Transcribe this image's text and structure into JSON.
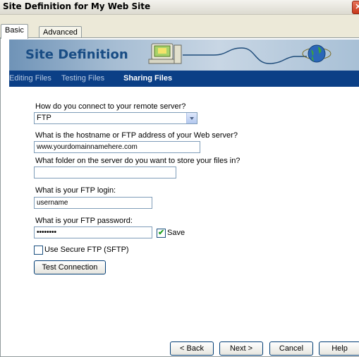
{
  "window": {
    "title": "Site Definition for My Web Site",
    "close_glyph": "✕"
  },
  "tabs": [
    {
      "label": "Basic"
    },
    {
      "label": "Advanced"
    }
  ],
  "banner": {
    "title": "Site Definition"
  },
  "nav": [
    {
      "label": "Editing Files"
    },
    {
      "label": "Testing Files"
    },
    {
      "label": "Sharing Files"
    }
  ],
  "form": {
    "connect_label": "How do you connect to your remote server?",
    "connect_value": "FTP",
    "host_label": "What is the hostname or FTP address of your Web server?",
    "host_value": "www.yourdomainnamehere.com",
    "folder_label": "What folder on the server do you want to store your files in?",
    "folder_value": "",
    "login_label": "What is your FTP login:",
    "login_value": "username",
    "password_label": "What is your FTP password:",
    "password_value": "••••••••",
    "save_label": "Save",
    "save_checked": true,
    "sftp_label": "Use Secure FTP (SFTP)",
    "sftp_checked": false,
    "test_button": "Test Connection"
  },
  "footer": {
    "back": "< Back",
    "next": "Next >",
    "cancel": "Cancel",
    "help": "Help"
  }
}
